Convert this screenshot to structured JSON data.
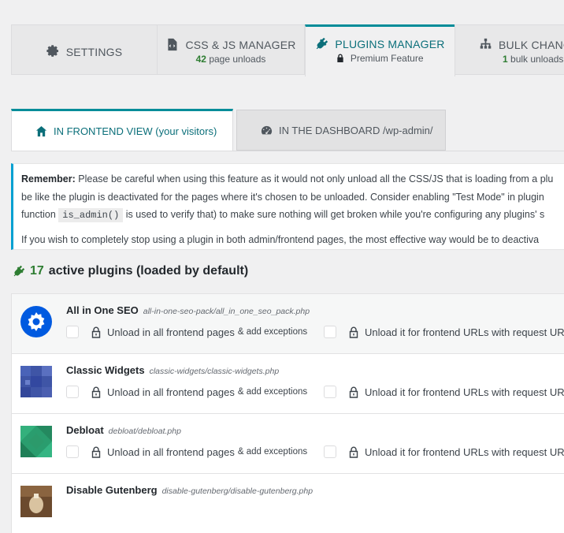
{
  "top_tabs": [
    {
      "label": "SETTINGS",
      "sub": "",
      "sub_count": "",
      "icon": "gear-icon"
    },
    {
      "label": "CSS & JS MANAGER",
      "sub_count": "42",
      "sub": "page unloads",
      "icon": "code-file-icon"
    },
    {
      "label": "PLUGINS MANAGER",
      "sub": "Premium Feature",
      "icon": "plug-icon",
      "active": true
    },
    {
      "label": "BULK CHANG",
      "sub_count": "1",
      "sub": "bulk unloads",
      "icon": "sitemap-icon"
    }
  ],
  "sub_tabs": {
    "frontend": "IN FRONTEND VIEW (your visitors)",
    "dashboard": "IN THE DASHBOARD /wp-admin/"
  },
  "notice": {
    "bold": "Remember:",
    "line1": " Please be careful when using this feature as it would not only unload all the CSS/JS that is loading from a plu",
    "line2": "be like the plugin is deactivated for the pages where it's chosen to be unloaded. Consider enabling \"Test Mode\" in plugin",
    "line3_pre": "function ",
    "line3_code": "is_admin()",
    "line3_post": " is used to verify that) to make sure nothing will get broken while you're configuring any plugins' s",
    "line4": "If you wish to completely stop using a plugin in both admin/frontend pages, the most effective way would be to deactiva"
  },
  "plugins_heading": {
    "count": "17",
    "text": "active plugins (loaded by default)"
  },
  "plugins": [
    {
      "name": "All in One SEO",
      "path": "all-in-one-seo-pack/all_in_one_seo_pack.php"
    },
    {
      "name": "Classic Widgets",
      "path": "classic-widgets/classic-widgets.php"
    },
    {
      "name": "Debloat",
      "path": "debloat/debloat.php"
    },
    {
      "name": "Disable Gutenberg",
      "path": "disable-gutenberg/disable-gutenberg.php"
    }
  ],
  "options": {
    "unload_all": "Unload in all frontend pages",
    "add_exceptions": "& add exceptions",
    "unload_request": "Unload it for frontend URLs with request URI"
  },
  "colors": {
    "accent": "#008c99",
    "green": "#2e7d32",
    "notice_border": "#00a0d2",
    "aioseo_blue": "#005ae0"
  }
}
